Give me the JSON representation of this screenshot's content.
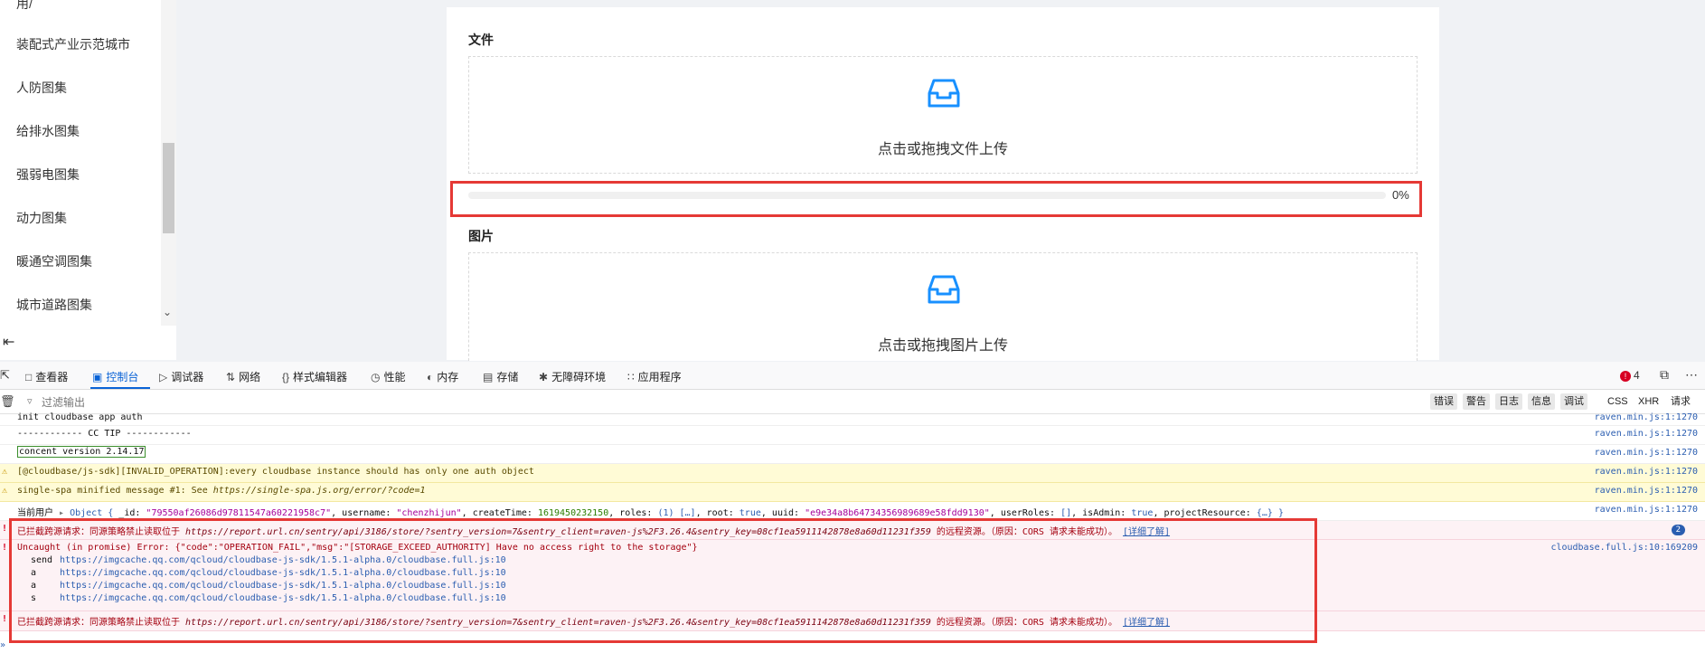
{
  "sidebar": {
    "items": [
      "用/",
      "装配式产业示范城市",
      "人防图集",
      "给排水图集",
      "强弱电图集",
      "动力图集",
      "暖通空调图集",
      "城市道路图集"
    ]
  },
  "upload": {
    "file_section_title": "文件",
    "file_drop_text": "点击或拖拽文件上传",
    "progress_percent": 0,
    "progress_text": "0%",
    "image_section_title": "图片",
    "image_drop_text": "点击或拖拽图片上传"
  },
  "devtools": {
    "tabs": {
      "inspector": "查看器",
      "console": "控制台",
      "debugger": "调试器",
      "network": "网络",
      "style_editor": "样式编辑器",
      "performance": "性能",
      "memory": "内存",
      "storage": "存储",
      "accessibility": "无障碍环境",
      "application": "应用程序"
    },
    "error_count": "4",
    "filter_placeholder": "过滤输出",
    "levels": {
      "errors": "错误",
      "warnings": "警告",
      "logs": "日志",
      "info": "信息",
      "debug": "调试"
    },
    "network_filters": {
      "css": "CSS",
      "xhr": "XHR",
      "requests": "请求"
    }
  },
  "console": {
    "rows": [
      {
        "msg": "init cloudbase app auth",
        "src": "raven.min.js:1:1270"
      },
      {
        "msg": "------------ CC TIP ------------",
        "src": "raven.min.js:1:1270"
      },
      {
        "msg": "concent version 2.14.17",
        "src": "raven.min.js:1:1270"
      },
      {
        "msg": "[@cloudbase/js-sdk][INVALID_OPERATION]:every cloudbase instance should has only one auth object",
        "src": "raven.min.js:1:1270"
      },
      {
        "msg_prefix": "single-spa minified message #1: See ",
        "msg_url": "https://single-spa.js.org/error/?code=1",
        "src": "raven.min.js:1:1270"
      },
      {
        "label": "当前用户",
        "obj_type": "Object",
        "id_key": "_id:",
        "id_val": "\"79550af26086d97811547a60221958c7\"",
        "username_key": "username:",
        "username_val": "\"chenzhijun\"",
        "ctime_key": "createTime:",
        "ctime_val": "1619450232150",
        "roles_key": "roles:",
        "roles_val": "(1) […]",
        "root_key": "root:",
        "root_val": "true",
        "uuid_key": "uuid:",
        "uuid_val": "\"e9e34a8b64734356989689e58fdd9130\"",
        "userroles_key": "userRoles:",
        "userroles_val": "[]",
        "isadmin_key": "isAdmin:",
        "isadmin_val": "true",
        "projres_key": "projectResource:",
        "projres_val": "{…}",
        "src": "raven.min.js:1:1270"
      }
    ],
    "cors_error": {
      "prefix": "已拦截跨源请求：同源策略禁止读取位于 ",
      "url": "https://report.url.cn/sentry/api/3186/store/?sentry_version=7&sentry_client=raven-js%2F3.26.4&sentry_key=08cf1ea5911142878e8a60d11231f359",
      "suffix": " 的远程资源。（原因：CORS 请求未能成功）。",
      "link": "[详细了解]",
      "count": "2"
    },
    "uncaught": {
      "msg": "Uncaught (in promise) Error: {\"code\":\"OPERATION_FAIL\",\"msg\":\"[STORAGE_EXCEED_AUTHORITY] Have no access right to the storage\"}",
      "src": "cloudbase.full.js:10:169209",
      "stack": [
        {
          "fn": "send",
          "url": "https://imgcache.qq.com/qcloud/cloudbase-js-sdk/1.5.1-alpha.0/cloudbase.full.js:10"
        },
        {
          "fn": "a",
          "url": "https://imgcache.qq.com/qcloud/cloudbase-js-sdk/1.5.1-alpha.0/cloudbase.full.js:10"
        },
        {
          "fn": "a",
          "url": "https://imgcache.qq.com/qcloud/cloudbase-js-sdk/1.5.1-alpha.0/cloudbase.full.js:10"
        },
        {
          "fn": "s",
          "url": "https://imgcache.qq.com/qcloud/cloudbase-js-sdk/1.5.1-alpha.0/cloudbase.full.js:10"
        }
      ]
    },
    "prompt": "»"
  }
}
